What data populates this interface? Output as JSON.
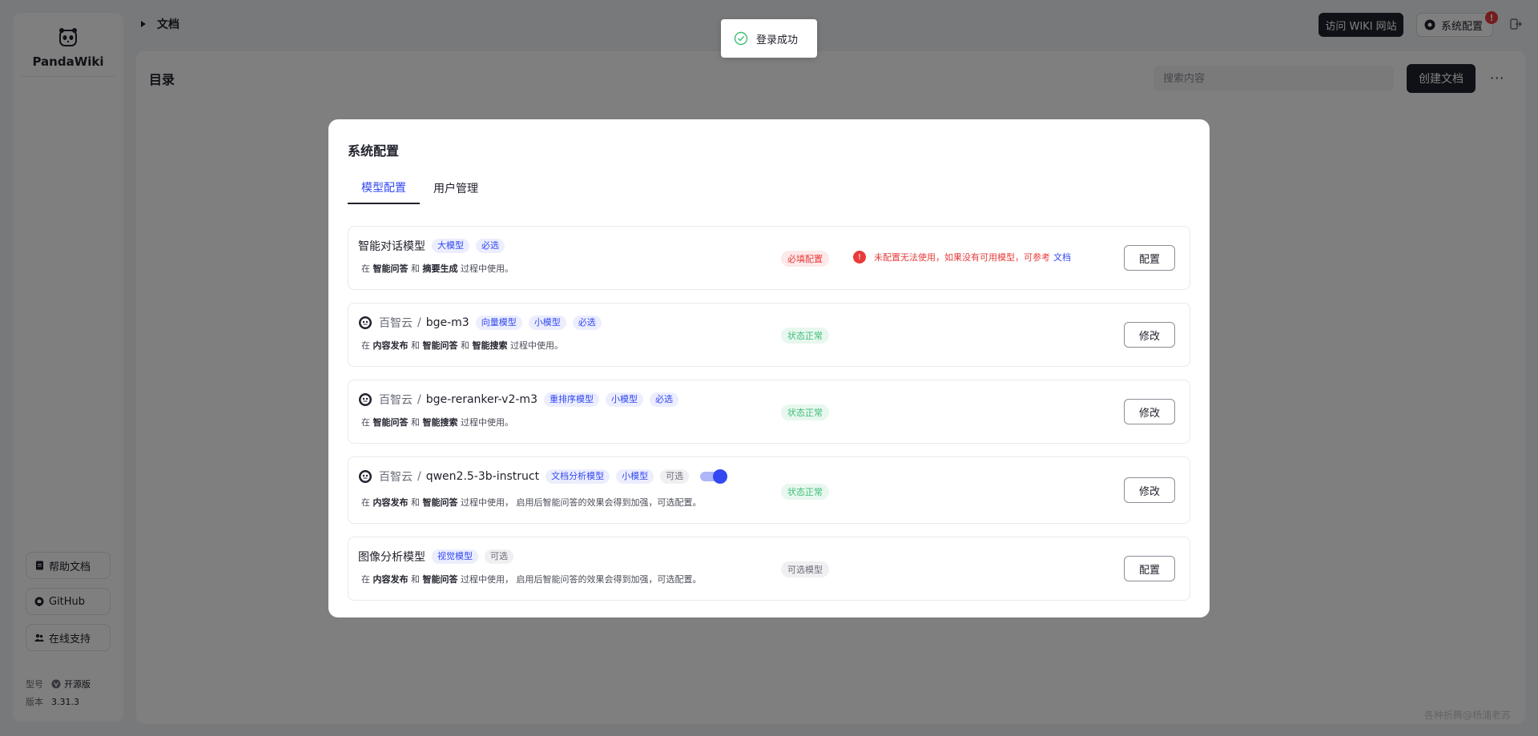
{
  "app": {
    "name": "PandaWiki"
  },
  "sidebar": {
    "help_label": "帮助文档",
    "github_label": "GitHub",
    "support_label": "在线支持",
    "model_label": "型号",
    "model_value": "开源版",
    "version_label": "版本",
    "version_value": "3.31.3"
  },
  "header": {
    "breadcrumb": "文档",
    "visit_wiki": "访问 WIKI 网站",
    "system_config": "系统配置",
    "alert_count": "!"
  },
  "main": {
    "title": "目录",
    "search_placeholder": "搜索内容",
    "create_label": "创建文档",
    "more_label": "···"
  },
  "toast": {
    "text": "登录成功"
  },
  "watermark": "各种折腾@杨浦老苏",
  "modal": {
    "title": "系统配置",
    "tabs": [
      {
        "label": "模型配置",
        "active": true
      },
      {
        "label": "用户管理",
        "active": false
      }
    ],
    "rows": [
      {
        "name": "智能对话模型",
        "tags": [
          "大模型",
          "必选"
        ],
        "desc_pre": "在",
        "desc_b1": "智能问答",
        "desc_mid": "和",
        "desc_b2": "摘要生成",
        "desc_post": "过程中使用。",
        "status": "必填配置",
        "warn": "未配置无法使用，如果没有可用模型，可参考",
        "warn_link": "文档",
        "button": "配置"
      },
      {
        "provider": "百智云",
        "model": "bge-m3",
        "tags": [
          "向量模型",
          "小模型",
          "必选"
        ],
        "desc_pre": "在",
        "desc_b1": "内容发布",
        "desc_mid": "和",
        "desc_b2": "智能问答",
        "desc_mid2": "和",
        "desc_b3": "智能搜索",
        "desc_post": "过程中使用。",
        "status": "状态正常",
        "button": "修改"
      },
      {
        "provider": "百智云",
        "model": "bge-reranker-v2-m3",
        "tags": [
          "重排序模型",
          "小模型",
          "必选"
        ],
        "desc_pre": "在",
        "desc_b1": "智能问答",
        "desc_mid": "和",
        "desc_b2": "智能搜索",
        "desc_post": "过程中使用。",
        "status": "状态正常",
        "button": "修改"
      },
      {
        "provider": "百智云",
        "model": "qwen2.5-3b-instruct",
        "tags": [
          "文档分析模型",
          "小模型",
          "可选"
        ],
        "toggle_on": true,
        "desc_pre": "在",
        "desc_b1": "内容发布",
        "desc_mid": "和",
        "desc_b2": "智能问答",
        "desc_post": "过程中使用， 启用后智能问答的效果会得到加强，可选配置。",
        "status": "状态正常",
        "button": "修改"
      },
      {
        "name": "图像分析模型",
        "tags": [
          "视觉模型",
          "可选"
        ],
        "desc_pre": "在",
        "desc_b1": "内容发布",
        "desc_mid": "和",
        "desc_b2": "智能问答",
        "desc_post": "过程中使用， 启用后智能问答的效果会得到加强，可选配置。",
        "status": "可选模型",
        "button": "配置"
      }
    ]
  },
  "colors": {
    "accent": "#3248f2",
    "dark": "#21222d",
    "ok": "#3cbf75",
    "danger": "#e83b3b"
  }
}
